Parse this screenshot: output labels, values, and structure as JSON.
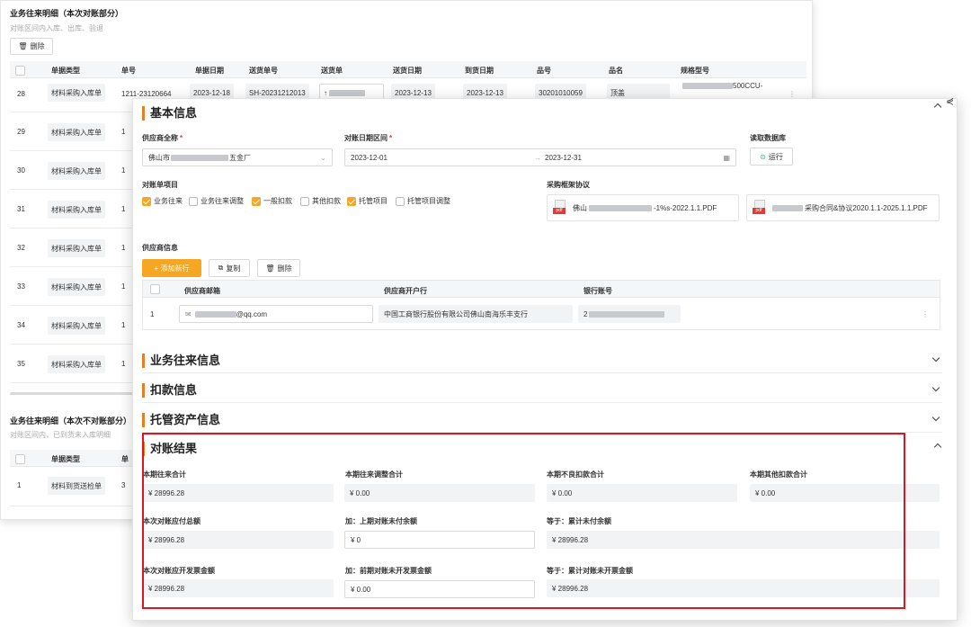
{
  "background": {
    "title": "业务往来明细（本次对账部分）",
    "subtitle": "对账区间内入库、出库、验退",
    "delete_label": "删除",
    "columns": [
      "单据类型",
      "单号",
      "单据日期",
      "送货单号",
      "送货单",
      "送货日期",
      "到货日期",
      "品号",
      "品名",
      "规格型号"
    ],
    "first_row": {
      "num": "28",
      "type": "材料采购入库单",
      "order": "1211-23120664",
      "date": "2023-12-18",
      "delivery_no": "SH-20231212013",
      "delivery_date": "2023-12-13",
      "arrival_date": "2023-12-13",
      "item_no": "30201010059",
      "item_name": "顶盖",
      "spec": "500CCU-"
    },
    "rows": [
      {
        "num": "29",
        "type": "材料采购入库单",
        "order": "1"
      },
      {
        "num": "30",
        "type": "材料采购入库单",
        "order": "1"
      },
      {
        "num": "31",
        "type": "材料采购入库单",
        "order": "1"
      },
      {
        "num": "32",
        "type": "材料采购入库单",
        "order": "1"
      },
      {
        "num": "33",
        "type": "材料采购入库单",
        "order": "1"
      },
      {
        "num": "34",
        "type": "材料采购入库单",
        "order": "1"
      },
      {
        "num": "35",
        "type": "材料采购入库单",
        "order": "1"
      }
    ],
    "title2": "业务往来明细（本次不对账部分）",
    "subtitle2": "对账区间内，已到货未入库明细",
    "table2_header": "单据类型",
    "table2_header_b": "单",
    "table2_row": {
      "num": "1",
      "type": "材料到货送检单",
      "order": "3"
    }
  },
  "modal": {
    "basic_title": "基本信息",
    "supplier_label": "供应商全称",
    "supplier_value_prefix": "佛山市",
    "supplier_value_suffix": "五金厂",
    "period_label": "对账日期区间",
    "period_start": "2023-12-01",
    "period_sep": "→",
    "period_end": "2023-12-31",
    "readdb_label": "读取数据库",
    "run_label": "运行",
    "items_label": "对账单项目",
    "items": [
      {
        "label": "业务往来",
        "checked": true
      },
      {
        "label": "业务往来调整",
        "checked": false
      },
      {
        "label": "一般扣款",
        "checked": true
      },
      {
        "label": "其他扣款",
        "checked": false
      },
      {
        "label": "托管项目",
        "checked": true
      },
      {
        "label": "托管项目调整",
        "checked": false
      }
    ],
    "framework_label": "采购框架协议",
    "pdf_tag": "pdf",
    "pdf1_prefix": "佛山",
    "pdf1_suffix": "-1%s-2022.1.1.PDF",
    "pdf2_suffix": "采购合同&协议2020.1.1-2025.1.1.PDF",
    "supplier_info_label": "供应商信息",
    "add_row_label": "+ 添加新行",
    "copy_label": "复制",
    "delete_label": "删除",
    "info_columns": [
      "供应商邮箱",
      "供应商开户行",
      "银行账号"
    ],
    "info_row": {
      "num": "1",
      "email_suffix": "@qq.com",
      "bank": "中国工商银行股份有限公司佛山南海乐丰支行",
      "account_prefix": "2"
    },
    "sections": [
      "业务往来信息",
      "扣款信息",
      "托管资产信息"
    ],
    "result_title": "对账结果",
    "result_row1": [
      {
        "label": "本期往来合计",
        "value": "¥ 28996.28"
      },
      {
        "label": "本期往来调整合计",
        "value": "¥ 0.00"
      },
      {
        "label": "本期不良扣款合计",
        "value": "¥ 0.00"
      },
      {
        "label": "本期其他扣款合计",
        "value": "¥ 0.00"
      }
    ],
    "result_row2": [
      {
        "label": "本次对账应付总额",
        "value": "¥ 28996.28"
      },
      {
        "label": "加：上期对账未付余额",
        "value": "¥ 0"
      },
      {
        "label": "等于：累计未付余额",
        "value": "¥ 28996.28"
      }
    ],
    "result_row3": [
      {
        "label": "本次对账应开发票金额",
        "value": "¥ 28996.28"
      },
      {
        "label": "加：前期对账未开发票金额",
        "value": "¥ 0.00"
      },
      {
        "label": "等于：累计对账未开票金额",
        "value": "¥ 28996.28"
      }
    ]
  }
}
